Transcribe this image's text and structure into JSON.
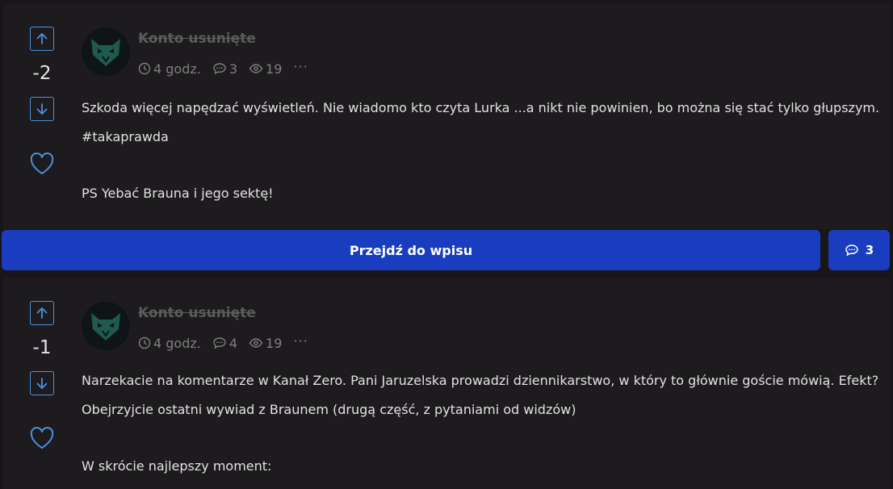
{
  "colors": {
    "accent": "#1a3dbf",
    "vote_icon": "#4a90e2",
    "background": "#191619",
    "card": "#1e1b1e"
  },
  "posts": [
    {
      "score": "-2",
      "author": "Konto usunięte",
      "time": "4 godz.",
      "comments": "3",
      "views": "19",
      "more": "···",
      "lines": [
        "Szkoda więcej napędzać wyświetleń. Nie wiadomo kto czyta Lurka ...a nikt nie powinien, bo można się stać tylko głupszym.",
        "#takaprawda",
        "PS Yebać Brauna i jego sektę!"
      ]
    },
    {
      "score": "-1",
      "author": "Konto usunięte",
      "time": "4 godz.",
      "comments": "4",
      "views": "19",
      "more": "···",
      "lines": [
        "Narzekacie na komentarze w Kanał Zero. Pani Jaruzelska prowadzi dziennikarstwo, w który to głównie goście mówią. Efekt?",
        "Obejrzyjcie ostatni wywiad z Braunem (drugą część, z pytaniami od widzów)",
        "W skrócie najlepszy moment:"
      ]
    }
  ],
  "actions": {
    "goto_label": "Przejdź do wpisu",
    "comments_count": "3"
  },
  "icons": [
    "arrow-up-icon",
    "arrow-down-icon",
    "heart-icon",
    "clock-icon",
    "comment-icon",
    "eye-icon"
  ]
}
